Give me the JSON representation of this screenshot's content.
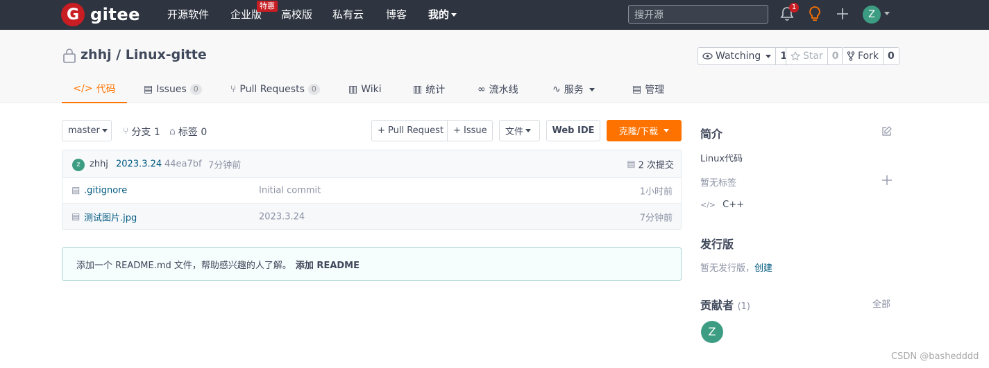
{
  "topnav": {
    "logo_mark": "G",
    "logo_text": "gitee",
    "items": [
      "开源软件",
      "企业版",
      "高校版",
      "私有云",
      "博客",
      "我的"
    ],
    "promo_badge": "特惠",
    "search_placeholder": "搜开源",
    "notification_count": "1",
    "avatar_initial": "Z"
  },
  "repo": {
    "title": "zhhj / Linux-gitte",
    "watching_label": "Watching",
    "watching_count": "1",
    "star_label": "Star",
    "star_count": "0",
    "fork_label": "Fork",
    "fork_count": "0"
  },
  "tabs": [
    {
      "label": "代码",
      "icon": "code-icon",
      "active": true
    },
    {
      "label": "Issues",
      "icon": "issues-icon",
      "count": "0"
    },
    {
      "label": "Pull Requests",
      "icon": "pull-request-icon",
      "count": "0"
    },
    {
      "label": "Wiki",
      "icon": "wiki-icon"
    },
    {
      "label": "统计",
      "icon": "stats-icon"
    },
    {
      "label": "流水线",
      "icon": "pipeline-icon"
    },
    {
      "label": "服务",
      "icon": "service-icon"
    },
    {
      "label": "管理",
      "icon": "manage-icon"
    }
  ],
  "toolbar": {
    "branch": "master",
    "branches": "分支 1",
    "tags": "标签 0",
    "pull_request": "+ Pull Request",
    "issue": "+ Issue",
    "file": "文件",
    "web_ide": "Web IDE",
    "clone": "克隆/下载"
  },
  "commit": {
    "avatar_initial": "z",
    "author": "zhhj",
    "message": "2023.3.24",
    "hash": "44ea7bf",
    "time": "7分钟前",
    "commits": "2 次提交"
  },
  "files": [
    {
      "name": ".gitignore",
      "message": "Initial commit",
      "time": "1小时前"
    },
    {
      "name": "测试图片.jpg",
      "message": "2023.3.24",
      "time": "7分钟前"
    }
  ],
  "readme_notice": {
    "text": "添加一个 README.md 文件，帮助感兴趣的人了解。",
    "link": "添加 README"
  },
  "sidebar": {
    "intro_title": "简介",
    "intro_text": "Linux代码",
    "no_tags": "暂无标签",
    "language": "C++",
    "release_title": "发行版",
    "release_text": "暂无发行版，",
    "release_create": "创建",
    "contrib_title": "贡献者",
    "contrib_count": "(1)",
    "contrib_all": "全部",
    "contrib_avatar": "Z"
  },
  "watermark": "CSDN @bashedddd",
  "colors": {
    "accent": "#fe7300",
    "nav_bg": "#2e3440",
    "brand_red": "#c71d23",
    "avatar_green": "#3d9d83"
  }
}
